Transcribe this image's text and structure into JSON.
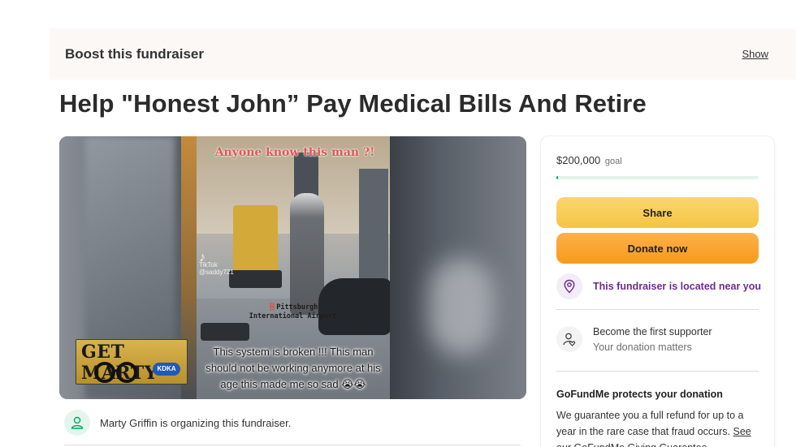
{
  "boost": {
    "title": "Boost this fundraiser",
    "show_label": "Show"
  },
  "title": "Help \"Honest John” Pay Medical Bills And Retire",
  "hero": {
    "overlay_top": "Anyone know this man ?!",
    "tiktok_label": "TikTok",
    "tiktok_handle": "@saddy721",
    "location_mark": "‼️",
    "location_line1": "Pittsburgh",
    "location_line2": "International Airport",
    "caption": "This system is broken !!! This man should not be working anymore at his age this made me so sad 😭😭",
    "logo_text": "GET MARTY",
    "logo_badge": "KDKA"
  },
  "organizer": {
    "text": "Marty Griffin is organizing this fundraiser."
  },
  "sidebar": {
    "goal_amount": "$200,000",
    "goal_word": "goal",
    "progress_fraction": 0.01,
    "share_label": "Share",
    "donate_label": "Donate now",
    "location_text": "This fundraiser is located near you",
    "supporter_title": "Become the first supporter",
    "supporter_sub": "Your donation matters",
    "protect_title": "GoFundMe protects your donation",
    "protect_body": "We guarantee you a full refund for up to a year in the rare case that fraud occurs.",
    "protect_link": "See our GoFundMe Giving Guarantee."
  },
  "colors": {
    "brand_green": "#02a95c",
    "share_yellow": "#f6c443",
    "donate_orange": "#f79a1b",
    "location_purple": "#6b2c91"
  }
}
